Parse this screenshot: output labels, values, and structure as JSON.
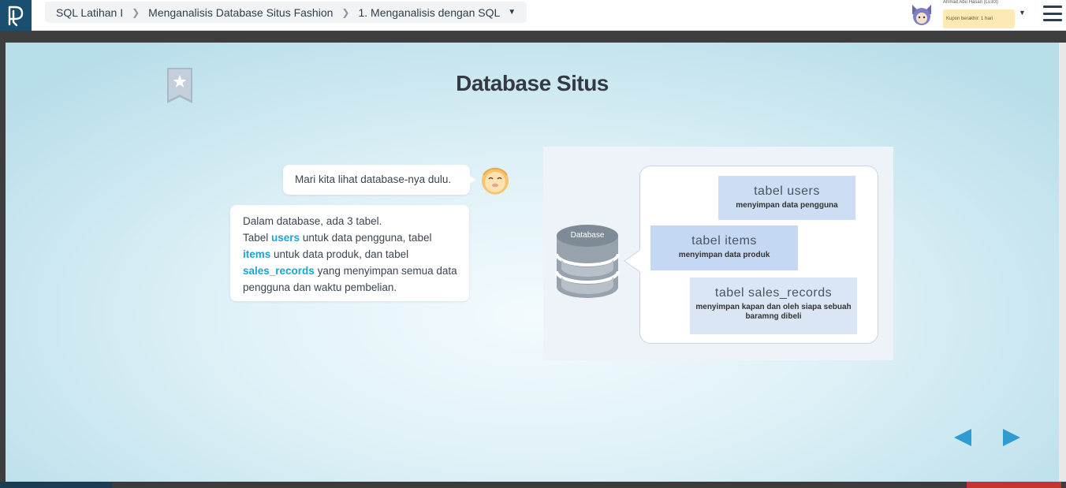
{
  "breadcrumb": {
    "course": "SQL Latihan I",
    "chapter": "Menganalisis Database Situs Fashion",
    "lesson": "1. Menganalisis dengan SQL"
  },
  "user": {
    "name": "Ahmad Abu Hasan (Lv.83)",
    "coupon": "Kupon berakhir: 1 hari"
  },
  "slide": {
    "title": "Database Situs",
    "bubble1": "Mari kita lihat database-nya dulu.",
    "bubble2": {
      "line1": "Dalam database, ada 3 tabel.",
      "p1": "Tabel ",
      "kw1": "users",
      "p2": " untuk data pengguna, tabel ",
      "kw2": "items",
      "p3": " untuk data produk, dan tabel ",
      "kw3": "sales_records",
      "p4": " yang menyimpan semua data pengguna dan waktu pembelian."
    }
  },
  "diagram": {
    "db_label": "Database",
    "tables": [
      {
        "title": "tabel users",
        "desc": "menyimpan data pengguna"
      },
      {
        "title": "tabel items",
        "desc": "menyimpan data produk"
      },
      {
        "title": "tabel sales_records",
        "desc": "menyimpan kapan dan oleh siapa sebuah baramng dibeli"
      }
    ]
  },
  "colors": {
    "accent": "#2f9bd0",
    "keyword": "#16a7d4",
    "logo_bg": "#1b4f72"
  },
  "icons": [
    "logo-icon",
    "chevron-right-icon",
    "caret-down-icon",
    "avatar-icon",
    "menu-icon",
    "bookmark-star-icon",
    "character-face-icon",
    "database-icon",
    "prev-arrow-icon",
    "next-arrow-icon"
  ]
}
